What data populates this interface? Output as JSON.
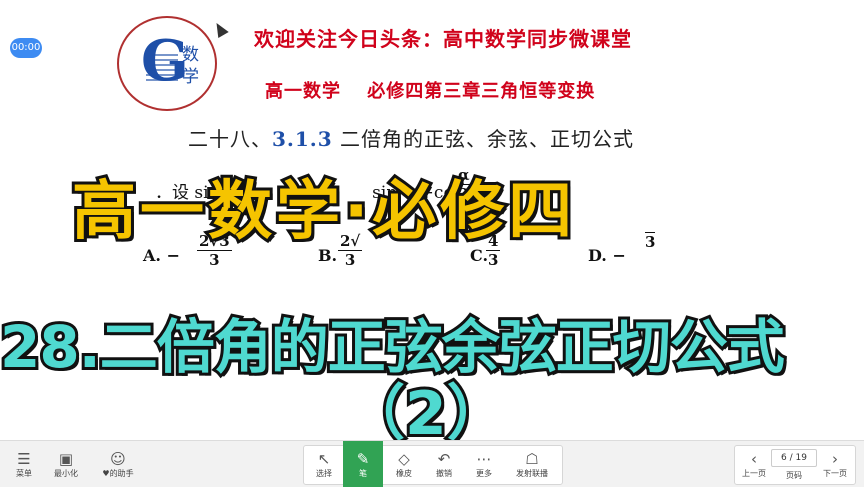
{
  "timer": "00:00",
  "logo": {
    "letter": "G",
    "text1": "数",
    "text2": "学"
  },
  "header": {
    "line1": "欢迎关注今日头条：高中数学同步微课堂",
    "line2": "高一数学　 必修四第三章三角恒等变换",
    "line3_prefix": "二十八、",
    "line3_num": "3.1.3",
    "line3_rest": " 二倍角的正弦、余弦、正切公式"
  },
  "question": {
    "stem": "．设 sin α=　　 α<　　　 sin　 +cos",
    "alpha_num": "α",
    "alpha_den": "2",
    "options": [
      {
        "label": "A.",
        "value": "−",
        "num": "2√3",
        "den": "3"
      },
      {
        "label": "B.",
        "value": "",
        "num": "2√",
        "den": "3"
      },
      {
        "label": "C.",
        "value": "",
        "num": "4",
        "den": "3"
      },
      {
        "label": "D.",
        "value": "−",
        "num": "",
        "den": "3"
      }
    ]
  },
  "overlay": {
    "title": "高一数学·必修四",
    "subtitle": "28.二倍角的正弦余弦正切公式",
    "part": "（2）"
  },
  "toolbar": {
    "left": [
      {
        "icon": "☰",
        "label": "菜单"
      },
      {
        "icon": "▣",
        "label": "最小化"
      },
      {
        "icon": "☺",
        "label": "♥的助手"
      }
    ],
    "tools": [
      {
        "icon": "↖",
        "label": "选择"
      },
      {
        "icon": "✎",
        "label": "笔"
      },
      {
        "icon": "◇",
        "label": "橡皮"
      },
      {
        "icon": "↶",
        "label": "撤销"
      },
      {
        "icon": "⋯",
        "label": "更多"
      },
      {
        "icon": "☖",
        "label": "发射联播"
      }
    ],
    "right": [
      {
        "icon": "‹",
        "label": "上一页"
      },
      {
        "label": "页码"
      },
      {
        "icon": "›",
        "label": "下一页"
      }
    ],
    "page_indicator": "6 / 19"
  },
  "colors": {
    "title_red": "#d0021b",
    "overlay_yellow": "#f5c400",
    "overlay_cyan": "#4fd9d0",
    "active_green": "#31a354",
    "timer_blue": "#3d8bf2"
  }
}
